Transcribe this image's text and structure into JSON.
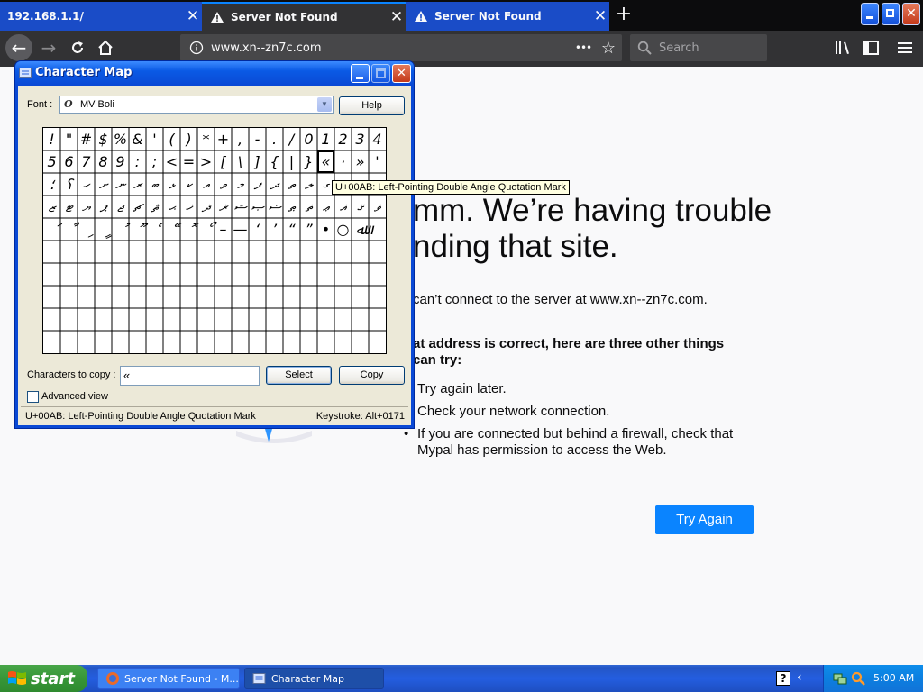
{
  "browser": {
    "tabs": [
      {
        "label": "192.168.1.1/",
        "active": false
      },
      {
        "label": "Server Not Found",
        "active": true
      },
      {
        "label": "Server Not Found",
        "active": false
      }
    ],
    "new_tab_symbol": "+",
    "url": "www.xn--zn7c.com",
    "url_menu_symbol": "•••",
    "search_placeholder": "Search",
    "accent_color": "#0a84ff"
  },
  "error_page": {
    "title_line1": "mm. We’re having trouble",
    "title_line2": "nding that site.",
    "description": "can’t connect to the server at www.xn--zn7c.com.",
    "subheading_line1": "at address is correct, here are three other things",
    "subheading_line2": "can try:",
    "suggestions": [
      "Try again later.",
      "Check your network connection.",
      "If you are connected but behind a firewall, check that Mypal has permission to access the Web."
    ],
    "try_again_label": "Try Again"
  },
  "charmap": {
    "title": "Character Map",
    "font_label": "Font :",
    "font_value": "MV Boli",
    "font_icon": "O",
    "help_label": "Help",
    "grid_rows": [
      [
        "!",
        "\"",
        "#",
        "$",
        "%",
        "&",
        "'",
        "(",
        ")",
        "*",
        "+",
        ",",
        "-",
        ".",
        "/",
        "0",
        "1",
        "2",
        "3",
        "4"
      ],
      [
        "5",
        "6",
        "7",
        "8",
        "9",
        ":",
        ";",
        "<",
        "=",
        ">",
        "[",
        "\\",
        "]",
        "{",
        "|",
        "}",
        "«",
        "·",
        "»",
        "'"
      ],
      [
        "؛",
        "؟",
        "ހ",
        "ށ",
        "ނ",
        "ރ",
        "ބ",
        "ޅ",
        "ކ",
        "އ",
        "ވ",
        "މ",
        "ފ",
        "ދ",
        "ތ",
        "ލ",
        "ގ",
        "ޏ",
        "ސ",
        "ޑ"
      ],
      [
        "ޒ",
        "ޓ",
        "ޔ",
        "ޕ",
        "ޖ",
        "ޗ",
        "ޘ",
        "ޙ",
        "ޚ",
        "ޛ",
        "ޜ",
        "ޝ",
        "ޞ",
        "ޟ",
        "ޠ",
        "ޡ",
        "ޢ",
        "ޣ",
        "ޤ",
        "ޥ"
      ],
      [
        "ަ",
        "ާ",
        "ި",
        "ީ",
        "ު",
        "ޫ",
        "ެ",
        "ޭ",
        "ޮ",
        "ޯ",
        "–",
        "—",
        "‘",
        "’",
        "“",
        "”",
        "•",
        "○",
        "ﷲ",
        ""
      ],
      [
        "",
        "",
        "",
        "",
        "",
        "",
        "",
        "",
        "",
        "",
        "",
        "",
        "",
        "",
        "",
        "",
        "",
        "",
        "",
        ""
      ],
      [
        "",
        "",
        "",
        "",
        "",
        "",
        "",
        "",
        "",
        "",
        "",
        "",
        "",
        "",
        "",
        "",
        "",
        "",
        "",
        ""
      ],
      [
        "",
        "",
        "",
        "",
        "",
        "",
        "",
        "",
        "",
        "",
        "",
        "",
        "",
        "",
        "",
        "",
        "",
        "",
        "",
        ""
      ],
      [
        "",
        "",
        "",
        "",
        "",
        "",
        "",
        "",
        "",
        "",
        "",
        "",
        "",
        "",
        "",
        "",
        "",
        "",
        "",
        ""
      ],
      [
        "",
        "",
        "",
        "",
        "",
        "",
        "",
        "",
        "",
        "",
        "",
        "",
        "",
        "",
        "",
        "",
        "",
        "",
        "",
        ""
      ]
    ],
    "selected_char": "«",
    "copy_label": "Characters to copy :",
    "copy_value": "«",
    "select_label": "Select",
    "copy_button_label": "Copy",
    "advanced_label": "Advanced view",
    "status_char": "U+00AB: Left-Pointing Double Angle Quotation Mark",
    "status_keystroke": "Keystroke: Alt+0171",
    "tooltip": "U+00AB: Left-Pointing Double Angle Quotation Mark"
  },
  "taskbar": {
    "start_label": "start",
    "tasks": [
      {
        "label": "Server Not Found - M...",
        "active": false
      },
      {
        "label": "Character Map",
        "active": true
      }
    ],
    "clock": "5:00 AM",
    "color": "#245ee0"
  }
}
